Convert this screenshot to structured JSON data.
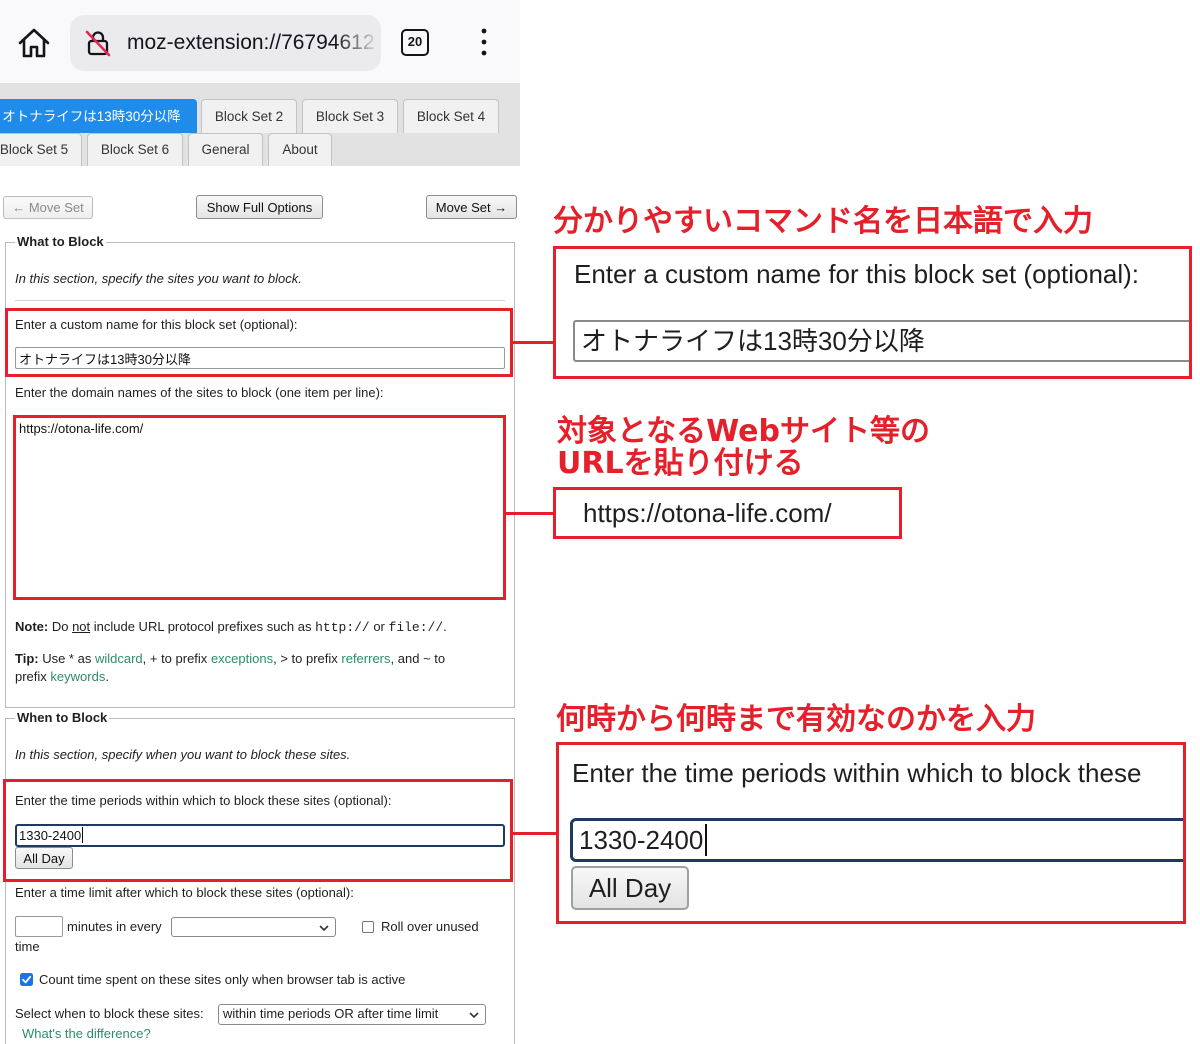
{
  "browser": {
    "url": "moz-extension://76794612",
    "tab_count": "20",
    "icons": [
      "home-icon",
      "insecure-lock-icon",
      "tab-counter-icon",
      "kebab-menu-icon"
    ]
  },
  "tabs": {
    "active_index": 0,
    "row1": [
      "オトナライフは13時30分以降",
      "Block Set 2",
      "Block Set 3",
      "Block Set 4"
    ],
    "row2": [
      "Block Set 5",
      "Block Set 6",
      "General",
      "About"
    ]
  },
  "toolbar": {
    "move_prev": "← Move Set",
    "show_full": "Show Full Options",
    "move_next": "Move Set →"
  },
  "what_to_block": {
    "legend": "What to Block",
    "intro": "In this section, specify the sites you want to block.",
    "name_label": "Enter a custom name for this block set (optional):",
    "name_value": "オトナライフは13時30分以降",
    "sites_label": "Enter the domain names of the sites to block (one item per line):",
    "sites_value": "https://otona-life.com/",
    "note": {
      "label": "Note:",
      "t1": " Do ",
      "em": "not",
      "t2": " include URL protocol prefixes such as ",
      "code1": "http://",
      "t3": " or ",
      "code2": "file://",
      "t4": "."
    },
    "tip": {
      "label": "Tip:",
      "t1": " Use * as ",
      "link1": "wildcard",
      "t2": ", + to prefix ",
      "link2": "exceptions",
      "t3": ", > to prefix ",
      "link3": "referrers",
      "t4": ", and ~ to prefix ",
      "link4": "keywords",
      "t5": "."
    }
  },
  "when_to_block": {
    "legend": "When to Block",
    "intro": "In this section, specify when you want to block these sites.",
    "periods_label": "Enter the time periods within which to block these sites (optional):",
    "periods_value": "1330-2400",
    "all_day": "All Day",
    "time_limit_label": "Enter a time limit after which to block these sites (optional):",
    "minutes_in_every": "minutes in every",
    "roll_over_label": "Roll over unused time",
    "roll_over_checked": false,
    "count_active_label": "Count time spent on these sites only when browser tab is active",
    "count_active_checked": true,
    "select_when_label": "Select when to block these sites:",
    "select_when_value": "within time periods OR after time limit",
    "difference_link": "What's the difference?"
  },
  "annotations": {
    "name": {
      "caption": "分かりやすいコマンド名を日本語で入力",
      "zoom_label": "Enter a custom name for this block set (optional):",
      "zoom_value": "オトナライフは13時30分以降"
    },
    "url": {
      "caption_lines": [
        "対象となるWebサイト等の",
        "URLを貼り付ける"
      ],
      "zoom_value": "https://otona-life.com/"
    },
    "time": {
      "caption": "何時から何時まで有効なのかを入力",
      "zoom_label": "Enter the time periods within which to block these",
      "zoom_value": "1330-2400",
      "zoom_button": "All Day"
    }
  },
  "colors": {
    "annotation_red": "#e5202a",
    "active_tab": "#1f8ceb",
    "link": "#2e8b6e",
    "focus_border": "#1e3a5f",
    "checkbox_checked": "#1a73e8"
  }
}
